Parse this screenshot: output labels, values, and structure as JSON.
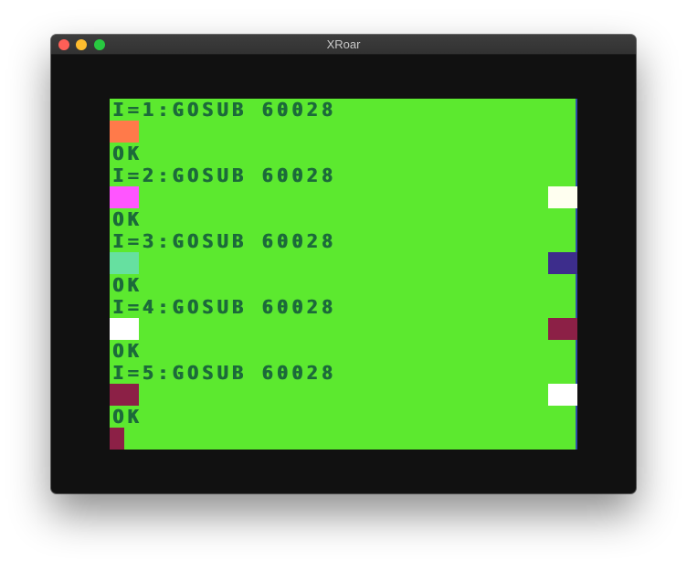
{
  "window": {
    "title": "XRoar"
  },
  "screen": {
    "background": "#5ce92f",
    "text_color": "#1c6a3a",
    "lines": [
      "I=1:GOSUB 60028",
      "OK",
      "I=2:GOSUB 60028",
      "OK",
      "I=3:GOSUB 60028",
      "OK",
      "I=4:GOSUB 60028",
      "OK",
      "I=5:GOSUB 60028",
      "OK"
    ],
    "color_blocks": [
      {
        "row": 1,
        "side": "left",
        "color": "#ff7a4a"
      },
      {
        "row": 3,
        "side": "left",
        "color": "#ff55ff"
      },
      {
        "row": 3,
        "side": "right",
        "color": "#fffff0"
      },
      {
        "row": 5,
        "side": "left",
        "color": "#66e0a0"
      },
      {
        "row": 5,
        "side": "right",
        "color": "#3d2d8c"
      },
      {
        "row": 7,
        "side": "left",
        "color": "#ffffff"
      },
      {
        "row": 7,
        "side": "right",
        "color": "#8c2046"
      },
      {
        "row": 9,
        "side": "left",
        "color": "#8c2046"
      },
      {
        "row": 9,
        "side": "right",
        "color": "#ffffff"
      },
      {
        "row": 11,
        "side": "left-small",
        "color": "#8c2046"
      }
    ]
  }
}
